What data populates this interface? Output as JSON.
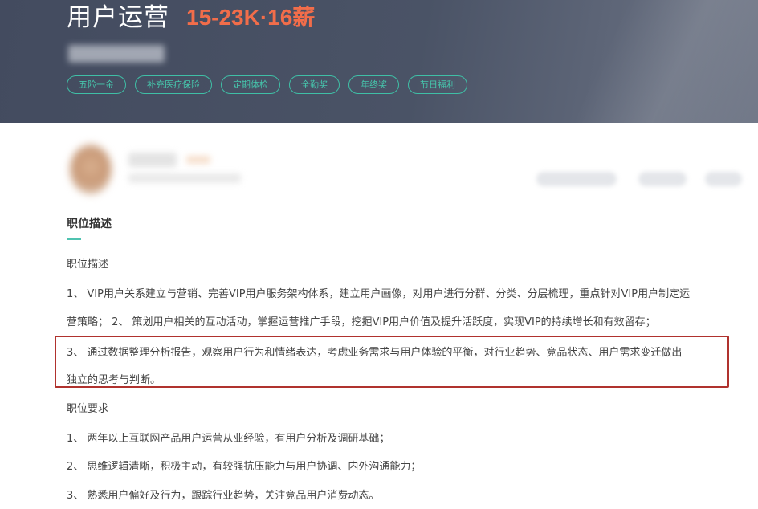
{
  "header": {
    "job_title": "用户运营",
    "salary": "15-23K·16薪",
    "benefit_tags": [
      "五险一金",
      "补充医疗保险",
      "定期体检",
      "全勤奖",
      "年终奖",
      "节日福利"
    ]
  },
  "description": {
    "section_title": "职位描述",
    "subheading": "职位描述",
    "lines": [
      "1、 VIP用户关系建立与营销、完善VIP用户服务架构体系，建立用户画像，对用户进行分群、分类、分层梳理，重点针对VIP用户制定运",
      "营策略；  2、 策划用户相关的互动活动，掌握运营推广手段，挖掘VIP用户价值及提升活跃度，实现VIP的持续增长和有效留存；",
      "3、 通过数据整理分析报告，观察用户行为和情绪表达，考虑业务需求与用户体验的平衡，对行业趋势、竞品状态、用户需求变迁做出",
      "独立的思考与判断。"
    ]
  },
  "requirements": {
    "subheading": "职位要求",
    "lines": [
      "1、 两年以上互联网产品用户运营从业经验，有用户分析及调研基础；",
      "2、 思维逻辑清晰，积极主动，有较强抗压能力与用户协调、内外沟通能力；",
      "3、 熟悉用户偏好及行为，跟踪行业趋势，关注竞品用户消费动态。"
    ]
  },
  "colors": {
    "header_bg": "#4a5366",
    "salary": "#f26d4a",
    "tag_accent": "#3fbfa6",
    "highlight_border": "#b0322e"
  }
}
